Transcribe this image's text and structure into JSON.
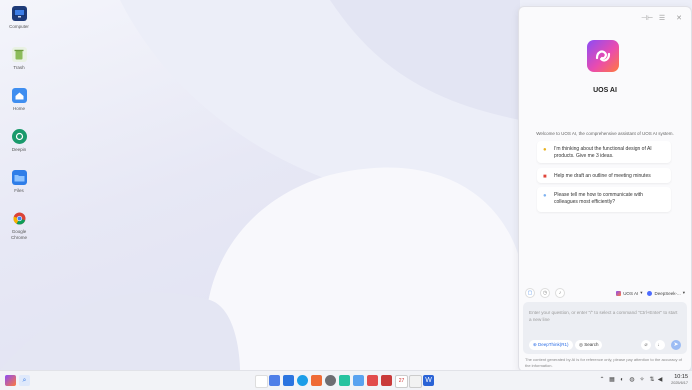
{
  "desktop": {
    "icons": [
      {
        "label": "Computer",
        "icon": "computer-icon"
      },
      {
        "label": "Trash",
        "icon": "trash-icon"
      },
      {
        "label": "Home",
        "icon": "home-folder-icon"
      },
      {
        "label": "Deepin",
        "icon": "app-store-icon"
      },
      {
        "label": "Files",
        "icon": "folder-icon"
      },
      {
        "label": "Google Chrome",
        "icon": "chrome-icon"
      }
    ]
  },
  "ai_panel": {
    "name": "UOS AI",
    "welcome": "Welcome to UOS AI, the comprehensive assistant of UOS AI system.",
    "suggestions": [
      {
        "icon": "lightbulb-icon",
        "text": "I'm thinking about the functional design of AI products. Give me 3 ideas."
      },
      {
        "icon": "car-icon",
        "text": "Help me draft an outline of meeting minutes"
      },
      {
        "icon": "bubble-icon",
        "text": "Please tell me how to communicate with colleagues most efficiently?"
      }
    ],
    "assistant_selector": "UOS AI",
    "model_selector": "DeepSeek-...",
    "input_placeholder": "Enter your question, or enter \"/\" to select a command \"Ctrl+Enter\" to start a new line",
    "deepthink_label": "DeepThink(R1)",
    "search_label": "Search",
    "disclaimer": "The content generated by AI is for reference only, please pay attention to the accuracy of the information."
  },
  "taskbar": {
    "time": "10:15",
    "date": "2025/6/17"
  },
  "colors": {
    "accent": "#2b6de6",
    "panel_bg": "#fafafc",
    "taskbar_bg": "#f2f3f7"
  }
}
